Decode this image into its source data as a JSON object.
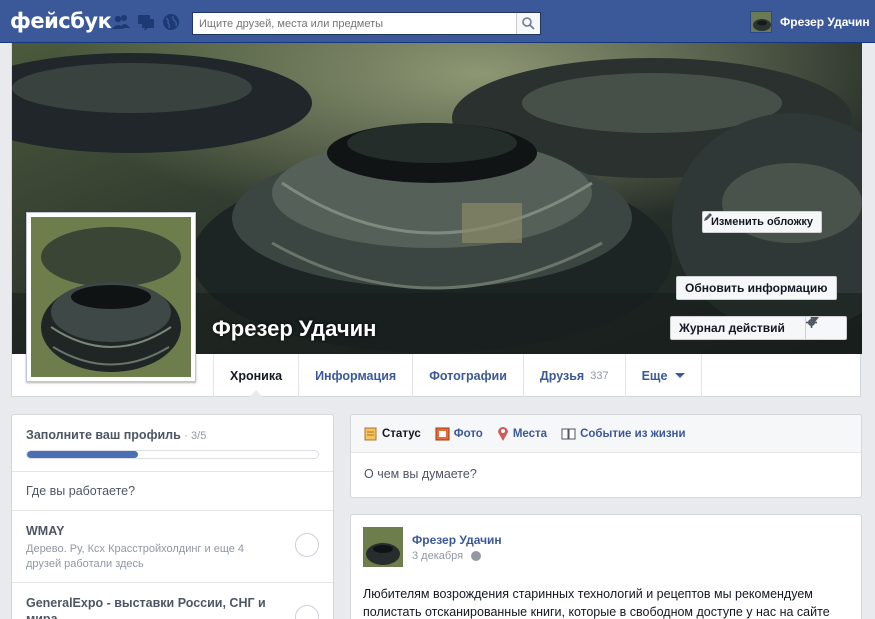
{
  "topbar": {
    "logo": "фейсбук",
    "search_placeholder": "Ищите друзей, места или предметы",
    "user_name": "Фрезер Удачин",
    "icons": [
      "friend-requests-icon",
      "messages-icon",
      "notifications-globe-icon",
      "search-icon"
    ]
  },
  "profile": {
    "name": "Фрезер Удачин",
    "change_cover": "Изменить обложку",
    "update_info": "Обновить информацию",
    "activity_log": "Журнал действий"
  },
  "tabs": [
    {
      "label": "Хроника"
    },
    {
      "label": "Информация"
    },
    {
      "label": "Фотографии"
    },
    {
      "label": "Друзья",
      "count": "337"
    },
    {
      "label": "Еще"
    }
  ],
  "completion": {
    "title": "Заполните ваш профиль",
    "fraction": "· 3/5",
    "progress_percent": 38,
    "question": "Где вы работаете?",
    "suggestions": [
      {
        "title": "WMAY",
        "subtitle": "Дерево. Ру, Ксх Красстройхолдинг и еще 4 друзей работали здесь"
      },
      {
        "title": "GeneralExpo - выставки России, СНГ и мира",
        "subtitle": ""
      }
    ]
  },
  "composer": {
    "tabs": [
      {
        "label": "Статус",
        "icon": "status-pencil-icon"
      },
      {
        "label": "Фото",
        "icon": "photo-icon"
      },
      {
        "label": "Места",
        "icon": "place-pin-icon"
      },
      {
        "label": "Событие из жизни",
        "icon": "life-event-book-icon"
      }
    ],
    "placeholder": "О чем вы думаете?"
  },
  "post": {
    "author": "Фрезер Удачин",
    "date": "3 декабря",
    "text": "Любителям возрождения старинных технологий и рецептов мы рекомендуем полистать отсканированные книги, которые в свободном доступе у нас на сайте"
  },
  "colors": {
    "brand_blue": "#3b5998",
    "page_bg": "#e9eaed",
    "progress_fill": "#4b6fb4"
  }
}
